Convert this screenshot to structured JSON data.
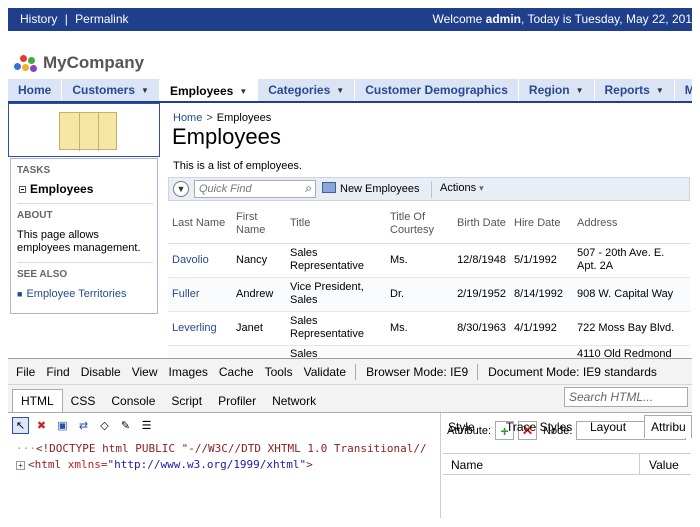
{
  "topbar": {
    "history": "History",
    "separator": "|",
    "permalink": "Permalink",
    "welcome_prefix": "Welcome",
    "user": "admin",
    "welcome_suffix": ", Today is Tuesday, May 22, 201"
  },
  "brand": {
    "name": "MyCompany"
  },
  "menu": {
    "tabs": [
      {
        "label": "Home",
        "caret": false,
        "active": false
      },
      {
        "label": "Customers",
        "caret": true,
        "active": false
      },
      {
        "label": "Employees",
        "caret": true,
        "active": true
      },
      {
        "label": "Categories",
        "caret": true,
        "active": false
      },
      {
        "label": "Customer Demographics",
        "caret": false,
        "active": false
      },
      {
        "label": "Region",
        "caret": true,
        "active": false
      },
      {
        "label": "Reports",
        "caret": true,
        "active": false
      },
      {
        "label": "Memb",
        "caret": false,
        "active": false
      }
    ]
  },
  "sidebar": {
    "tasks_heading": "TASKS",
    "task": "Employees",
    "about_heading": "ABOUT",
    "about_text_1": "This page allows",
    "about_text_2": "employees management.",
    "seealso_heading": "SEE ALSO",
    "seealso_link": "Employee Territories"
  },
  "page": {
    "breadcrumb_home": "Home",
    "breadcrumb_sep": ">",
    "breadcrumb_current": "Employees",
    "title": "Employees",
    "description": "This is a list of employees."
  },
  "toolbar": {
    "quick_find_placeholder": "Quick Find",
    "new_label": "New Employees",
    "actions_label": "Actions"
  },
  "grid": {
    "headers": {
      "last_name": "Last Name",
      "first_name_1": "First",
      "first_name_2": "Name",
      "title": "Title",
      "courtesy_1": "Title Of",
      "courtesy_2": "Courtesy",
      "birth": "Birth Date",
      "hire": "Hire Date",
      "address": "Address"
    },
    "rows": [
      {
        "last": "Davolio",
        "first": "Nancy",
        "title1": "Sales",
        "title2": "Representative",
        "courtesy": "Ms.",
        "birth": "12/8/1948",
        "hire": "5/1/1992",
        "addr1": "507 - 20th Ave. E.",
        "addr2": "Apt. 2A"
      },
      {
        "last": "Fuller",
        "first": "Andrew",
        "title1": "Vice President,",
        "title2": "Sales",
        "courtesy": "Dr.",
        "birth": "2/19/1952",
        "hire": "8/14/1992",
        "addr1": "908 W. Capital Way",
        "addr2": ""
      },
      {
        "last": "Leverling",
        "first": "Janet",
        "title1": "Sales",
        "title2": "Representative",
        "courtesy": "Ms.",
        "birth": "8/30/1963",
        "hire": "4/1/1992",
        "addr1": "722 Moss Bay Blvd.",
        "addr2": ""
      },
      {
        "last": "",
        "first": "",
        "title1": "Sales",
        "title2": "",
        "courtesy": "",
        "birth": "",
        "hire": "",
        "addr1": "4110 Old Redmond",
        "addr2": ""
      }
    ]
  },
  "devtools": {
    "menu": [
      {
        "label": "File"
      },
      {
        "label": "Find"
      },
      {
        "label": "Disable"
      },
      {
        "label": "View"
      },
      {
        "label": "Images"
      },
      {
        "label": "Cache"
      },
      {
        "label": "Tools"
      },
      {
        "label": "Validate"
      }
    ],
    "browser_mode_label": "Browser Mode:",
    "browser_mode_value": "IE9",
    "document_mode_label": "Document Mode:",
    "document_mode_value": "IE9 standards",
    "tabs": [
      {
        "label": "HTML",
        "active": true
      },
      {
        "label": "CSS",
        "active": false
      },
      {
        "label": "Console",
        "active": false
      },
      {
        "label": "Script",
        "active": false
      },
      {
        "label": "Profiler",
        "active": false
      },
      {
        "label": "Network",
        "active": false
      }
    ],
    "search_placeholder": "Search HTML...",
    "doctype": "<!DOCTYPE html PUBLIC \"-//W3C//DTD XHTML 1.0 Transitional//",
    "html_open": "<html",
    "html_attr": " xmlns=",
    "html_val": "\"http://www.w3.org/1999/xhtml\"",
    "html_close": ">",
    "pane_tabs": [
      {
        "label": "Style",
        "active": false
      },
      {
        "label": "Trace Styles",
        "active": false
      },
      {
        "label": "Layout",
        "active": false
      },
      {
        "label": "Attribu",
        "active": true
      }
    ],
    "attribute_label": "Attribute:",
    "node_label": "Node:",
    "name_header": "Name",
    "value_header": "Value"
  }
}
